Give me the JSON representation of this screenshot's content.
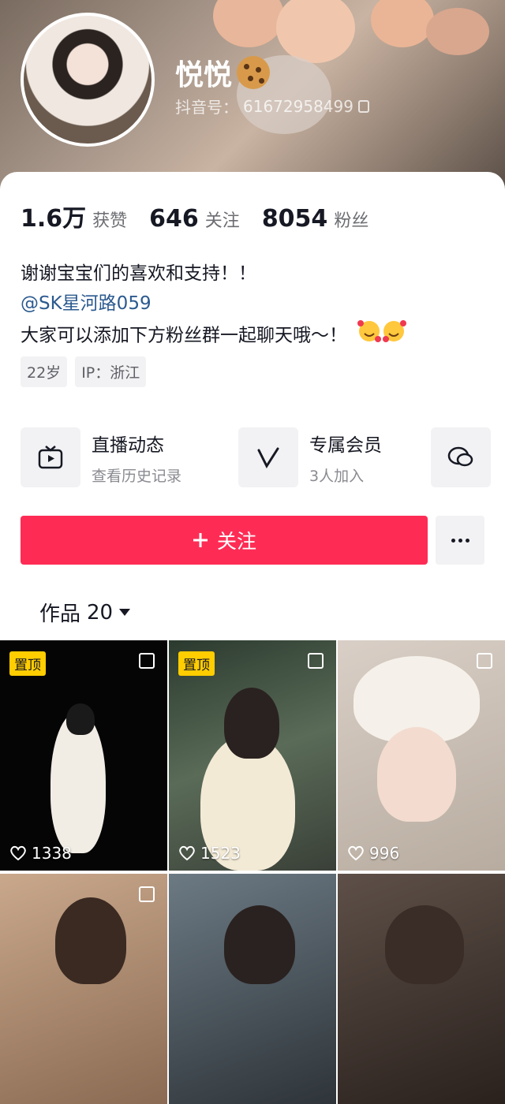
{
  "profile": {
    "name": "悦悦",
    "name_emoji": "cookie-emoji",
    "douyin_id_label": "抖音号：",
    "douyin_id": "61672958499"
  },
  "stats": [
    {
      "num": "1.6万",
      "label": "获赞"
    },
    {
      "num": "646",
      "label": "关注"
    },
    {
      "num": "8054",
      "label": "粉丝"
    }
  ],
  "bio": {
    "line1": "谢谢宝宝们的喜欢和支持！！",
    "mention": "@SK星河路059",
    "line3": "大家可以添加下方粉丝群一起聊天哦～！",
    "line3_emoji": "smiling-hearts-emoji"
  },
  "tags": [
    "22岁",
    "IP：浙江"
  ],
  "entries": [
    {
      "icon": "tv-icon",
      "title": "直播动态",
      "sub": "查看历史记录"
    },
    {
      "icon": "vip-icon",
      "title": "专属会员",
      "sub": "3人加入"
    },
    {
      "icon": "chat-icon",
      "title": "",
      "sub": ""
    }
  ],
  "actions": {
    "follow_label": "关注",
    "more_icon": "more-icon"
  },
  "works": {
    "label": "作品",
    "count": "20"
  },
  "videos": [
    {
      "pinned": true,
      "pin_label": "置顶",
      "likes": "1338"
    },
    {
      "pinned": true,
      "pin_label": "置顶",
      "likes": "1523"
    },
    {
      "pinned": false,
      "likes": "996"
    },
    {
      "pinned": false,
      "likes": ""
    },
    {
      "pinned": false,
      "likes": ""
    },
    {
      "pinned": false,
      "likes": ""
    }
  ],
  "colors": {
    "accent": "#fe2c55",
    "pin": "#ffcd00",
    "mention": "#2b5a8f"
  }
}
